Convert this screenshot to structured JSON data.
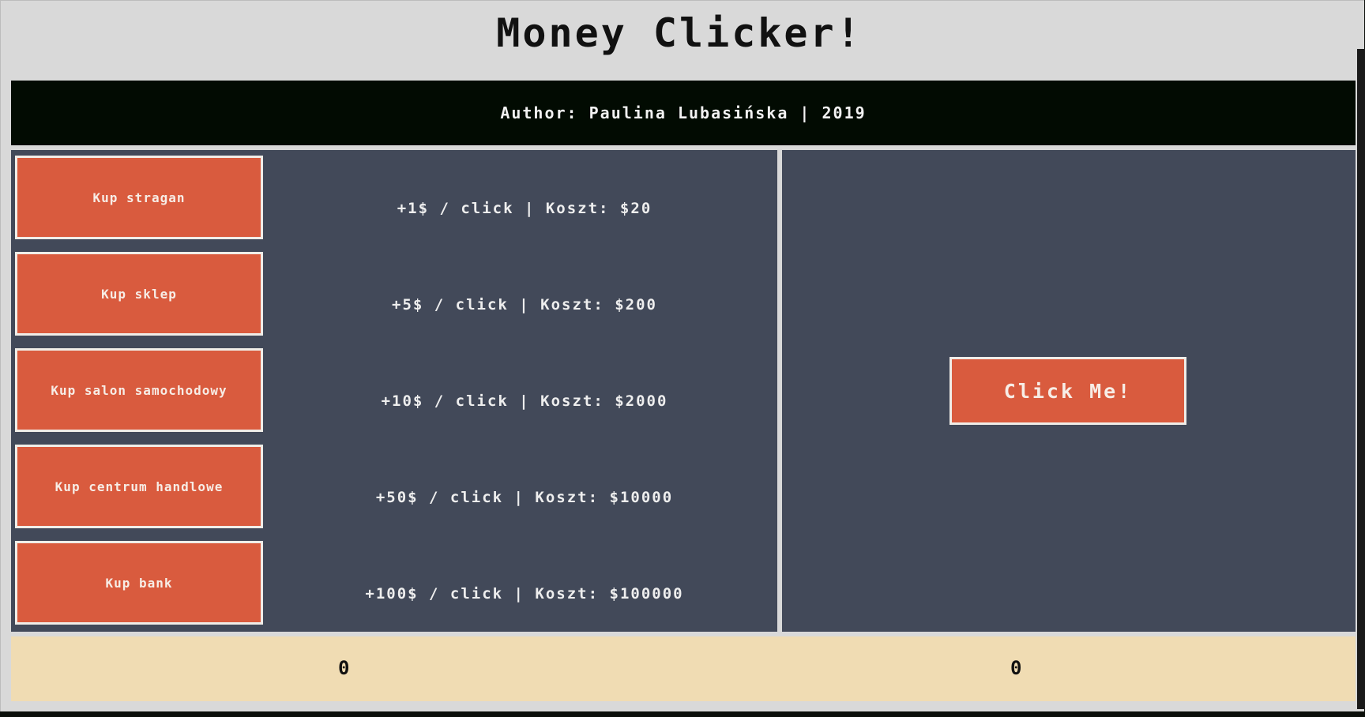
{
  "header": {
    "title": "Money Clicker!",
    "author": "Author: Paulina Lubasińska | 2019"
  },
  "shop": {
    "items": [
      {
        "label": "Kup stragan",
        "info": "+1$ / click | Koszt: $20"
      },
      {
        "label": "Kup sklep",
        "info": "+5$ / click | Koszt: $200"
      },
      {
        "label": "Kup salon samochodowy",
        "info": "+10$ / click | Koszt: $2000"
      },
      {
        "label": "Kup centrum handlowe",
        "info": "+50$ / click | Koszt: $10000"
      },
      {
        "label": "Kup bank",
        "info": "+100$ / click | Koszt: $100000"
      }
    ]
  },
  "clicker": {
    "label": "Click Me!"
  },
  "counters": {
    "left": "0",
    "right": "0"
  },
  "colors": {
    "background": "#d9d9d9",
    "header_bar": "#020b02",
    "panel": "#424959",
    "button": "#d95b3e",
    "counter_bar": "#f0dcb3"
  }
}
